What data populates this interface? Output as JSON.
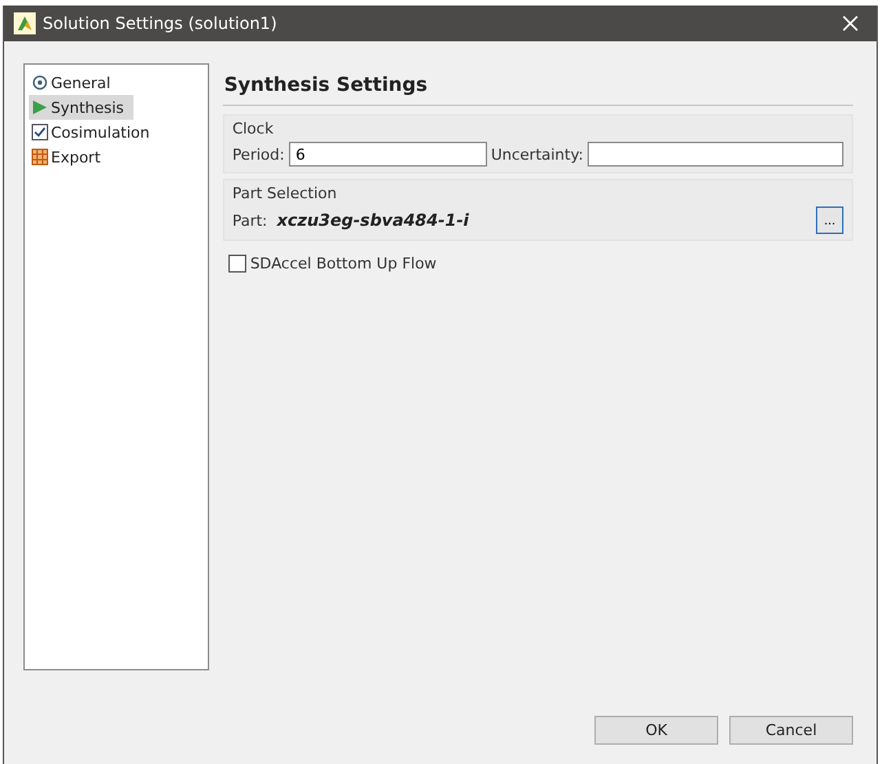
{
  "window": {
    "title": "Solution Settings (solution1)"
  },
  "sidebar": {
    "items": [
      {
        "label": "General",
        "kind": "general",
        "selected": false
      },
      {
        "label": "Synthesis",
        "kind": "synthesis",
        "selected": true
      },
      {
        "label": "Cosimulation",
        "kind": "cosimulation",
        "selected": false
      },
      {
        "label": "Export",
        "kind": "export",
        "selected": false
      }
    ]
  },
  "page": {
    "title": "Synthesis Settings",
    "clock": {
      "title": "Clock",
      "period_label": "Period:",
      "period_value": "6",
      "uncertainty_label": "Uncertainty:"
    },
    "part_selection": {
      "title": "Part Selection",
      "part_label": "Part:",
      "part_value": "xczu3eg-sbva484-1-i",
      "browse_button": "..."
    },
    "sdaccel": {
      "label": "SDAccel Bottom Up Flow",
      "checked": false
    }
  },
  "buttons": [
    "OK",
    "Cancel"
  ]
}
